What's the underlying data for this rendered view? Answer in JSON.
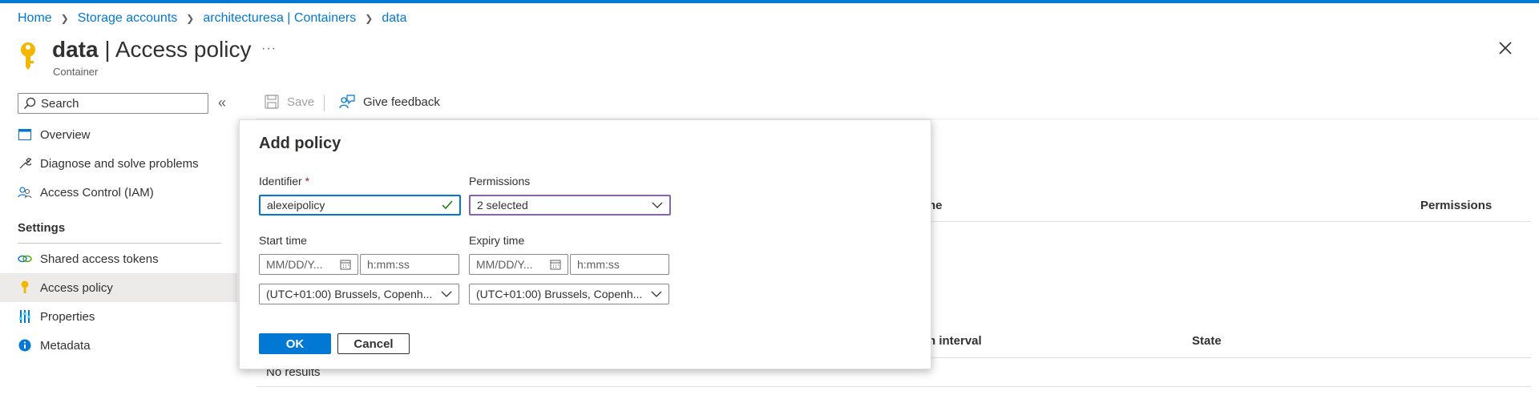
{
  "breadcrumb": {
    "items": [
      "Home",
      "Storage accounts",
      "architecturesa | Containers",
      "data"
    ]
  },
  "header": {
    "title_bold": "data",
    "title_rest": " | Access policy",
    "subtitle": "Container",
    "more": "···"
  },
  "sidebar": {
    "search_placeholder": "Search",
    "items": [
      {
        "label": "Overview",
        "icon": "overview-icon"
      },
      {
        "label": "Diagnose and solve problems",
        "icon": "wrench-icon"
      },
      {
        "label": "Access Control (IAM)",
        "icon": "people-icon"
      }
    ],
    "section": "Settings",
    "settings_items": [
      {
        "label": "Shared access tokens",
        "icon": "link-icon"
      },
      {
        "label": "Access policy",
        "icon": "key-icon",
        "active": true
      },
      {
        "label": "Properties",
        "icon": "properties-icon"
      },
      {
        "label": "Metadata",
        "icon": "info-icon"
      }
    ]
  },
  "toolbar": {
    "save_label": "Save",
    "feedback_label": "Give feedback"
  },
  "background_table": {
    "policies_partial_header": "ne",
    "permissions_header": "Permissions",
    "immutability_partial_header": "n interval",
    "state_header": "State",
    "no_results": "No results"
  },
  "dialog": {
    "title": "Add policy",
    "identifier_label": "Identifier",
    "required_mark": "*",
    "identifier_value": "alexeipolicy",
    "permissions_label": "Permissions",
    "permissions_value": "2 selected",
    "start_time_label": "Start time",
    "expiry_time_label": "Expiry time",
    "date_placeholder": "MM/DD/Y...",
    "time_placeholder": "h:mm:ss",
    "start_timezone": "(UTC+01:00) Brussels, Copenh...",
    "expiry_timezone": "(UTC+01:00) Brussels, Copenh...",
    "ok_label": "OK",
    "cancel_label": "Cancel"
  },
  "colors": {
    "accent": "#0078d4",
    "key_gold": "#f2b700",
    "permissions_border": "#8764b8",
    "valid_check": "#107c10"
  }
}
